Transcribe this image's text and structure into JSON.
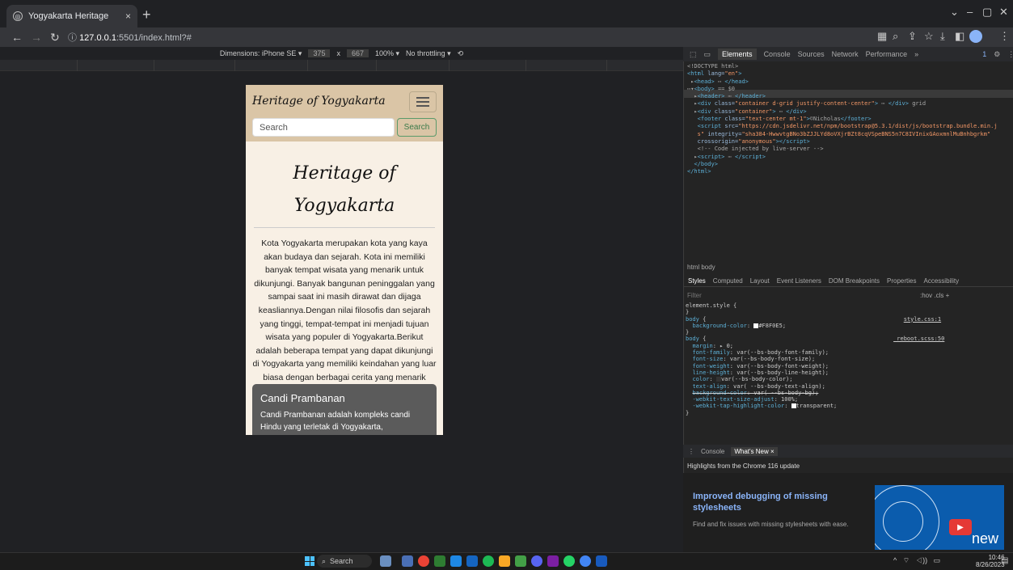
{
  "browser": {
    "tab_title": "Yogyakarta Heritage",
    "tab_close": "×",
    "new_tab": "+",
    "url_host": "127.0.0.1",
    "url_rest": ":5501/index.html?#"
  },
  "device_toolbar": {
    "device": "Dimensions: iPhone SE ▾",
    "width": "375",
    "x": "x",
    "height": "667",
    "zoom": "100% ▾",
    "throttle": "No throttling ▾"
  },
  "page": {
    "brand": "Heritage of Yogyakarta",
    "search_placeholder": "Search",
    "search_button": "Search",
    "heading": "Heritage of Yogyakarta",
    "intro": "Kota Yogyakarta merupakan kota yang kaya akan budaya dan sejarah. Kota ini memiliki banyak tempat wisata yang menarik untuk dikunjungi. Banyak bangunan peninggalan yang sampai saat ini masih dirawat dan dijaga keasliannya.Dengan nilai filosofis dan sejarah yang tinggi, tempat-tempat ini menjadi tujuan wisata yang populer di Yogyakarta.Berikut adalah beberapa tempat yang dapat dikunjungi di Yogyakarta yang memiliki keindahan yang luar biasa dengan berbagai cerita yang menarik disetiap tempatnya.",
    "card_title": "Candi Prambanan",
    "card_text": "Candi Prambanan adalah kompleks candi Hindu yang terletak di Yogyakarta,"
  },
  "devtools": {
    "tabs": [
      "Elements",
      "Console",
      "Sources",
      "Network",
      "Performance",
      "»"
    ],
    "issues_badge": "1",
    "breadcrumb": "html  body",
    "styles_tabs": [
      "Styles",
      "Computed",
      "Layout",
      "Event Listeners",
      "DOM Breakpoints",
      "Properties",
      "Accessibility"
    ],
    "filter_placeholder": "Filter",
    "filter_right": ":hov  .cls  +",
    "drawer_tabs": [
      "Console",
      "What's New ×"
    ],
    "highlights": "Highlights from the Chrome 116 update",
    "promo_title": "Improved debugging of missing stylesheets",
    "promo_desc": "Find and fix issues with missing stylesheets with ease.",
    "promo_badge": "new"
  },
  "taskbar": {
    "search": "Search",
    "time": "10:46",
    "date": "8/26/2023"
  }
}
